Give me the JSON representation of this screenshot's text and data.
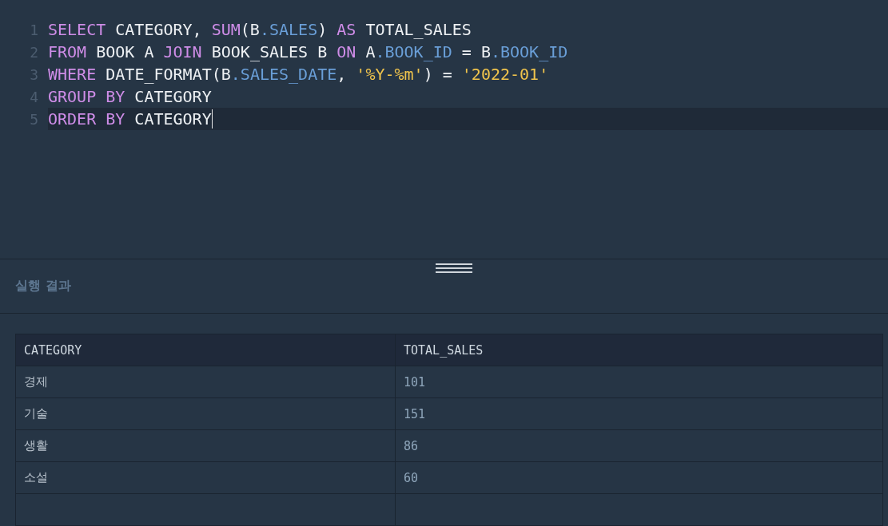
{
  "editor": {
    "lines": [
      {
        "number": "1",
        "active": false,
        "tokens": [
          {
            "kind": "keyword",
            "text": "SELECT"
          },
          {
            "kind": "plain",
            "text": " CATEGORY, "
          },
          {
            "kind": "keyword",
            "text": "SUM"
          },
          {
            "kind": "plain",
            "text": "(B"
          },
          {
            "kind": "property",
            "text": ".SALES"
          },
          {
            "kind": "plain",
            "text": ") "
          },
          {
            "kind": "keyword",
            "text": "AS"
          },
          {
            "kind": "plain",
            "text": " TOTAL_SALES"
          }
        ]
      },
      {
        "number": "2",
        "active": false,
        "tokens": [
          {
            "kind": "keyword",
            "text": "FROM"
          },
          {
            "kind": "plain",
            "text": " BOOK A "
          },
          {
            "kind": "keyword",
            "text": "JOIN"
          },
          {
            "kind": "plain",
            "text": " BOOK_SALES B "
          },
          {
            "kind": "keyword",
            "text": "ON"
          },
          {
            "kind": "plain",
            "text": " A"
          },
          {
            "kind": "property",
            "text": ".BOOK_ID"
          },
          {
            "kind": "plain",
            "text": " = B"
          },
          {
            "kind": "property",
            "text": ".BOOK_ID"
          }
        ]
      },
      {
        "number": "3",
        "active": false,
        "tokens": [
          {
            "kind": "keyword",
            "text": "WHERE"
          },
          {
            "kind": "plain",
            "text": " DATE_FORMAT(B"
          },
          {
            "kind": "property",
            "text": ".SALES_DATE"
          },
          {
            "kind": "plain",
            "text": ", "
          },
          {
            "kind": "string",
            "text": "'%Y-%m'"
          },
          {
            "kind": "plain",
            "text": ") = "
          },
          {
            "kind": "string",
            "text": "'2022-01'"
          }
        ]
      },
      {
        "number": "4",
        "active": false,
        "tokens": [
          {
            "kind": "keyword",
            "text": "GROUP BY"
          },
          {
            "kind": "plain",
            "text": " CATEGORY"
          }
        ]
      },
      {
        "number": "5",
        "active": true,
        "tokens": [
          {
            "kind": "keyword",
            "text": "ORDER BY"
          },
          {
            "kind": "plain",
            "text": " CATEGORY"
          }
        ]
      }
    ]
  },
  "results": {
    "title": "실행 결과",
    "table": {
      "columns": [
        "CATEGORY",
        "TOTAL_SALES"
      ],
      "rows": [
        [
          "경제",
          "101"
        ],
        [
          "기술",
          "151"
        ],
        [
          "생활",
          "86"
        ],
        [
          "소설",
          "60"
        ]
      ]
    }
  }
}
